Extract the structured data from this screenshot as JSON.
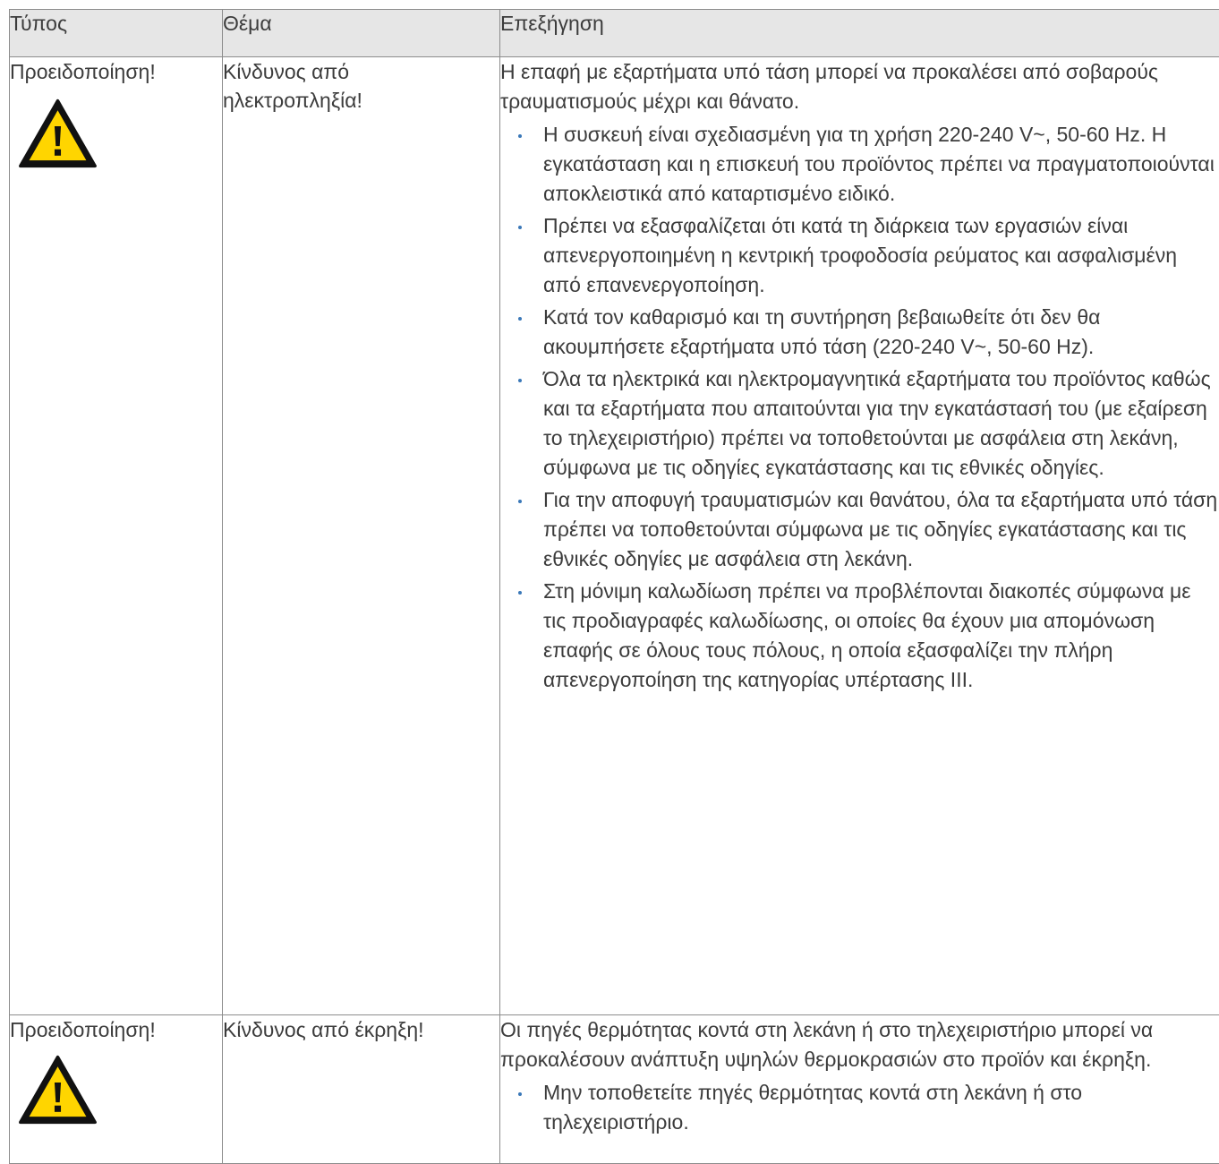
{
  "header": {
    "col_type": "Τύπος",
    "col_topic": "Θέμα",
    "col_explanation": "Επεξήγηση"
  },
  "colors": {
    "header_bg": "#e6e6e6",
    "border": "#8c8c8c",
    "text": "#3c3c3c",
    "bullet": "#3a78b8",
    "warning_yellow": "#ffd500"
  },
  "rows": [
    {
      "type": "Προειδοποίηση!",
      "icon": "warning-triangle-icon",
      "topic": "Κίνδυνος από ηλεκτροπληξία!",
      "intro": "Η επαφή με εξαρτήματα υπό τάση μπορεί να προκαλέσει από σοβαρούς τραυματισμούς μέχρι και θάνατο.",
      "bullets": [
        "Η συσκευή είναι σχεδιασμένη για τη χρήση 220-240 V~, 50-60 Hz. Η εγκατάσταση και η επισκευή του προϊόντος πρέπει να πραγματοποιούνται αποκλειστικά από καταρτισμένο ειδικό.",
        "Πρέπει να εξασφαλίζεται ότι κατά τη διάρκεια των εργασιών είναι απενεργοποιημένη η κεντρική τροφοδοσία ρεύματος και ασφαλισμένη από επανενεργοποίηση.",
        "Κατά τον καθαρισμό και τη συντήρηση βεβαιωθείτε ότι δεν θα ακουμπήσετε εξαρτήματα υπό τάση (220-240 V~, 50-60 Hz).",
        "Όλα τα ηλεκτρικά και ηλεκτρομαγνητικά εξαρτήματα του προϊόντος καθώς και τα εξαρτήματα που απαιτούνται για την εγκατάστασή του (με εξαίρεση το τηλεχειριστήριο) πρέπει να τοποθετούνται με ασφάλεια στη λεκάνη, σύμφωνα με τις οδηγίες εγκατάστασης και τις εθνικές οδηγίες.",
        "Για την αποφυγή τραυματισμών και θανάτου, όλα τα εξαρτήματα υπό τάση πρέπει να τοποθετούνται σύμφωνα με τις οδηγίες εγκατάστασης και τις εθνικές οδηγίες με ασφάλεια στη λεκάνη.",
        "Στη μόνιμη καλωδίωση πρέπει να προβλέπονται διακοπές σύμφωνα με τις προδιαγραφές καλωδίωσης, οι οποίες θα έχουν μια απομόνωση επαφής σε όλους τους πόλους, η οποία εξασφαλίζει την πλήρη απενεργοποίηση της κατηγορίας υπέρτασης III."
      ]
    },
    {
      "type": "Προειδοποίηση!",
      "icon": "warning-triangle-icon",
      "topic": "Κίνδυνος από έκρηξη!",
      "intro": "Οι πηγές θερμότητας κοντά στη λεκάνη ή στο τηλεχειριστήριο μπορεί να προκαλέσουν ανάπτυξη υψηλών θερμοκρασιών στο προϊόν και έκρηξη.",
      "bullets": [
        "Μην τοποθετείτε πηγές θερμότητας κοντά στη λεκάνη ή στο τηλεχειριστήριο."
      ]
    }
  ]
}
